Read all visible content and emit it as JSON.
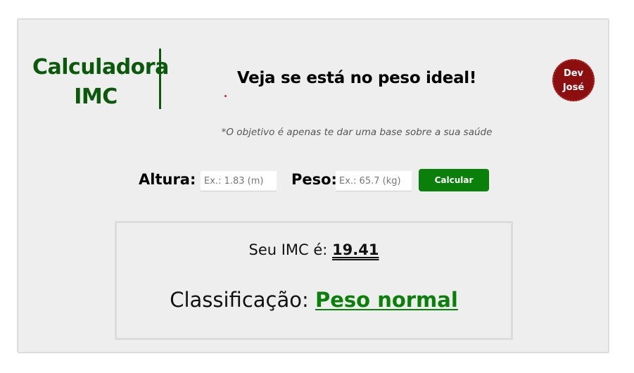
{
  "header": {
    "brand_line1": "Calculadora",
    "brand_line2": "IMC",
    "headline": "Veja se está no peso ideal!",
    "dev_badge_line1": "Dev",
    "dev_badge_line2": "José"
  },
  "subtitle": "*O objetivo é apenas te dar uma base sobre a sua saúde",
  "form": {
    "altura_label": "Altura:",
    "altura_placeholder": "Ex.: 1.83 (m)",
    "peso_label": "Peso:",
    "peso_placeholder": "Ex.: 65.7 (kg)",
    "calcular_label": "Calcular"
  },
  "result": {
    "imc_prefix": "Seu IMC é:",
    "imc_value": "19.41",
    "classification_prefix": "Classificação:",
    "classification_value": "Peso normal"
  },
  "colors": {
    "brand_green": "#0b5a0b",
    "button_green": "#0a7f0a",
    "badge_red": "#8b0f0f",
    "card_bg": "#eeeeee"
  }
}
